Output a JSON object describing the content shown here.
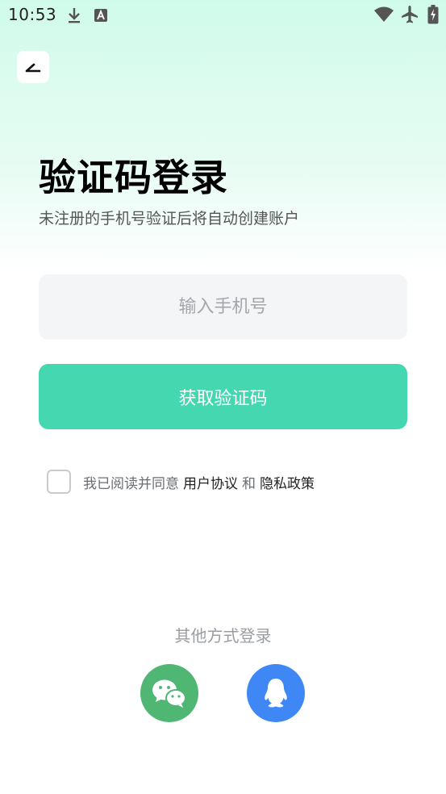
{
  "status_bar": {
    "time": "10:53",
    "icons": [
      "download-icon",
      "a-app-icon",
      "wifi-icon",
      "airplane-icon",
      "battery-charging-icon"
    ]
  },
  "nav": {
    "back_icon": "back-arrow-icon"
  },
  "header": {
    "title": "验证码登录",
    "subtitle": "未注册的手机号验证后将自动创建账户"
  },
  "form": {
    "phone_placeholder": "输入手机号",
    "phone_value": "",
    "get_code_label": "获取验证码",
    "button_color": "#45d8b0"
  },
  "agreement": {
    "prefix": "我已阅读并同意",
    "user_agreement": "用户协议",
    "and": "和",
    "privacy_policy": "隐私政策",
    "checked": false
  },
  "other_login": {
    "label": "其他方式登录",
    "options": [
      {
        "name": "wechat",
        "icon": "wechat-icon",
        "color": "#50b674"
      },
      {
        "name": "qq",
        "icon": "qq-icon",
        "color": "#3f87f5"
      }
    ]
  }
}
